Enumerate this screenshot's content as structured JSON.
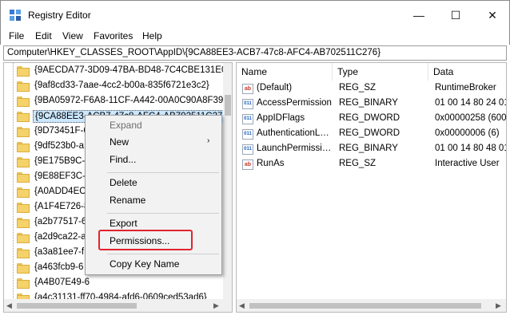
{
  "window": {
    "title": "Registry Editor",
    "minimize_symbol": "—",
    "maximize_symbol": "☐",
    "close_symbol": "✕",
    "icon": "registry-editor-icon"
  },
  "menu": [
    "File",
    "Edit",
    "View",
    "Favorites",
    "Help"
  ],
  "address": "Computer\\HKEY_CLASSES_ROOT\\AppID\\{9CA88EE3-ACB7-47c8-AFC4-AB702511C276}",
  "tree": {
    "items": [
      "{9AECDA77-3D09-47BA-BD48-7C4CBE131E0…",
      "{9af8cd33-7aae-4cc2-b00a-835f6721e3c2}",
      "{9BA05972-F6A8-11CF-A442-00A0C90A8F39}",
      "{9CA88EE3-ACB7-47c8-AFC4-AB702511C276}",
      "{9D73451F-6",
      "{9df523b0-a",
      "{9E175B9C-F",
      "{9E88EF3C-E",
      "{A0ADD4EC",
      "{A1F4E726-8",
      "{a2b77517-6",
      "{a2d9ca22-a",
      "{a3a81ee7-f",
      "{a463fcb9-6",
      "{A4B07E49-6",
      "{a4c31131-ff70-4984-afd6-0609ced53ad6}",
      "{a…"
    ],
    "selected_index": 3
  },
  "list": {
    "columns": [
      "Name",
      "Type",
      "Data"
    ],
    "rows": [
      {
        "icon": "ab",
        "name": "(Default)",
        "type": "REG_SZ",
        "data": "RuntimeBroker"
      },
      {
        "icon": "bin",
        "name": "AccessPermission",
        "type": "REG_BINARY",
        "data": "01 00 14 80 24 01"
      },
      {
        "icon": "bin",
        "name": "AppIDFlags",
        "type": "REG_DWORD",
        "data": "0x00000258 (600"
      },
      {
        "icon": "bin",
        "name": "AuthenticationL…",
        "type": "REG_DWORD",
        "data": "0x00000006 (6)"
      },
      {
        "icon": "bin",
        "name": "LaunchPermissi…",
        "type": "REG_BINARY",
        "data": "01 00 14 80 48 01"
      },
      {
        "icon": "ab",
        "name": "RunAs",
        "type": "REG_SZ",
        "data": "Interactive User"
      }
    ],
    "icon_text_string": "ab",
    "icon_text_binary": "011"
  },
  "context_menu": {
    "expand": "Expand",
    "new": "New",
    "find": "Find...",
    "delete": "Delete",
    "rename": "Rename",
    "export": "Export",
    "permissions": "Permissions...",
    "copy_key_name": "Copy Key Name",
    "submenu_arrow": "›"
  },
  "colors": {
    "selection": "#cce8ff",
    "highlight_box": "#e0242f",
    "folder": "#f5d26a"
  }
}
